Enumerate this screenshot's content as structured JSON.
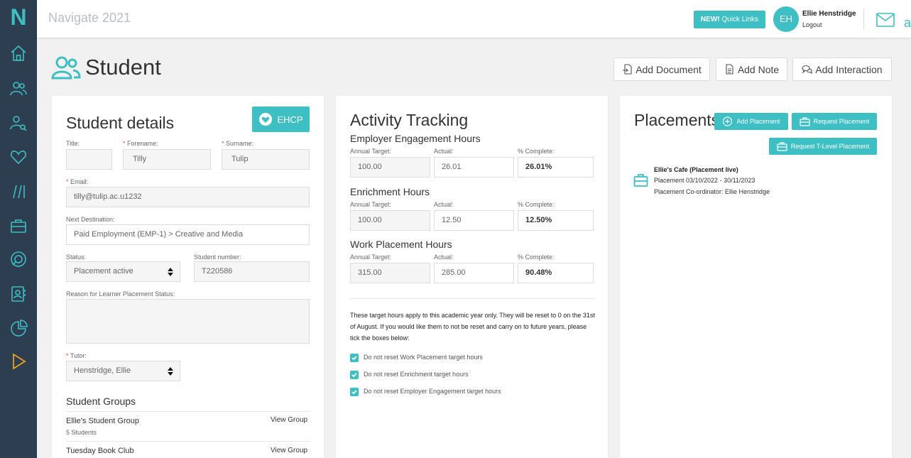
{
  "app": {
    "logo": "N",
    "title": "Navigate 2021"
  },
  "topbar": {
    "quick_links_badge": "NEW!",
    "quick_links_label": "Quick Links",
    "avatar_initials": "EH",
    "user_name": "Ellie Henstridge",
    "logout": "Logout",
    "edge_text": "a"
  },
  "page": {
    "title": "Student",
    "buttons": {
      "add_document": "Add Document",
      "add_note": "Add Note",
      "add_interaction": "Add Interaction"
    }
  },
  "student": {
    "heading": "Student details",
    "ehcp": "EHCP",
    "title_label": "Title:",
    "title_value": "",
    "forename_label": "Forename:",
    "forename": "Tilly",
    "surname_label": "Surname:",
    "surname": "Tulip",
    "email_label": "Email:",
    "email": "tilly@tulip.ac.u1232",
    "next_destination_label": "Next Destination:",
    "next_destination": "Paid Employment (EMP-1) > Creative and Media",
    "status_label": "Status:",
    "status": "Placement active",
    "student_number_label": "Student number:",
    "student_number": "T220586",
    "reason_label": "Reason for Learner Placement Status:",
    "reason": "",
    "tutor_label": "Tutor:",
    "tutor": "Henstridge, Ellie",
    "groups_heading": "Student Groups",
    "groups": [
      {
        "name": "Ellie's Student Group",
        "meta": "5 Students",
        "action": "View Group"
      },
      {
        "name": "Tuesday Book Club",
        "meta": "",
        "action": "View Group"
      }
    ]
  },
  "activity": {
    "heading": "Activity Tracking",
    "col_target": "Annual Target:",
    "col_actual": "Actual:",
    "col_complete": "% Complete:",
    "sections": [
      {
        "name": "Employer Engagement Hours",
        "target": "100.00",
        "actual": "26.01",
        "complete": "26.01%"
      },
      {
        "name": "Enrichment Hours",
        "target": "100.00",
        "actual": "12.50",
        "complete": "12.50%"
      },
      {
        "name": "Work Placement Hours",
        "target": "315.00",
        "actual": "285.00",
        "complete": "90.48%"
      }
    ],
    "note": "These target hours apply to this academic year only. They will be reset to 0 on the 31st of August. If you would like them to not be reset and carry on to future years, please tick the boxes below:",
    "checkboxes": [
      {
        "label": "Do not reset Work Placement target hours",
        "checked": true
      },
      {
        "label": "Do not reset Enrichment target hours",
        "checked": true
      },
      {
        "label": "Do not reset Employer Engagement target hours",
        "checked": true
      }
    ]
  },
  "placements": {
    "heading": "Placements",
    "add_placement": "Add Placement",
    "request_placement": "Request Placement",
    "request_tlevel": "Request T-Level Placement",
    "item": {
      "title": "Ellie's Cafe (Placement live)",
      "dates": "Placement 03/10/2022 - 30/11/2023",
      "coordinator": "Placement Co-ordinator: Ellie Henstridge"
    }
  },
  "colors": {
    "accent": "#3dbfc4",
    "sidebar": "#2c3e50",
    "active_icon": "#f0a020"
  }
}
